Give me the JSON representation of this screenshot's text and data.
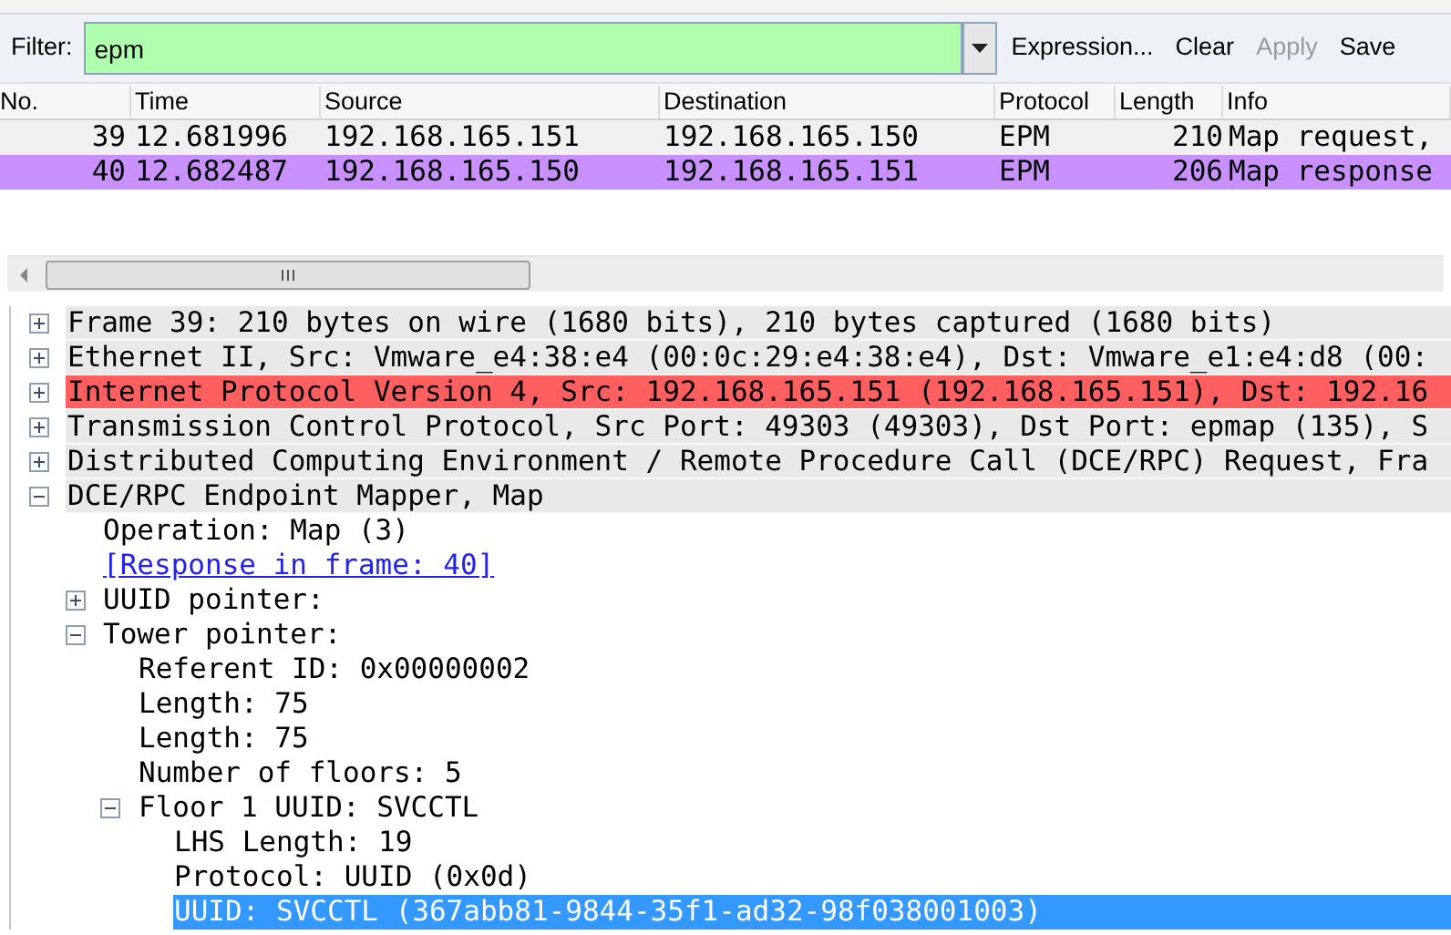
{
  "filter": {
    "label": "Filter:",
    "value": "epm",
    "valid": true,
    "buttons": [
      {
        "label": "Expression...",
        "disabled": false
      },
      {
        "label": "Clear",
        "disabled": false
      },
      {
        "label": "Apply",
        "disabled": true
      },
      {
        "label": "Save",
        "disabled": false
      }
    ]
  },
  "packet_list": {
    "columns": [
      "No.",
      "Time",
      "Source",
      "Destination",
      "Protocol",
      "Length",
      "Info"
    ],
    "rows": [
      {
        "cells": [
          "39",
          "12.681996",
          "192.168.165.151",
          "192.168.165.150",
          "EPM",
          "210",
          "Map request,"
        ],
        "color": "#f0f0f0"
      },
      {
        "cells": [
          "40",
          "12.682487",
          "192.168.165.150",
          "192.168.165.151",
          "EPM",
          "206",
          "Map response"
        ],
        "color": "#c891ff"
      }
    ]
  },
  "details": [
    {
      "text": "Frame 39: 210 bytes on wire (1680 bits), 210 bytes captured (1680 bits)",
      "expanded": false,
      "selected": false
    },
    {
      "text": "Ethernet II, Src: Vmware_e4:38:e4 (00:0c:29:e4:38:e4), Dst: Vmware_e1:e4:d8 (00:",
      "expanded": false,
      "selected": false
    },
    {
      "text": "Internet Protocol Version 4, Src: 192.168.165.151 (192.168.165.151), Dst: 192.16",
      "expanded": false,
      "selected": false,
      "color": "#ff5f5f"
    },
    {
      "text": "Transmission Control Protocol, Src Port: 49303 (49303), Dst Port: epmap (135), S",
      "expanded": false,
      "selected": false
    },
    {
      "text": "Distributed Computing Environment / Remote Procedure Call (DCE/RPC) Request, Fra",
      "expanded": false,
      "selected": false
    },
    {
      "text": "DCE/RPC Endpoint Mapper, Map",
      "expanded": true,
      "selected": false,
      "children": [
        {
          "text": "Operation: Map (3)",
          "selected": false
        },
        {
          "text": "[Response in frame: 40]",
          "kind": "link",
          "selected": false
        },
        {
          "text": "UUID pointer:",
          "expanded": false,
          "selected": false
        },
        {
          "text": "Tower pointer:",
          "expanded": true,
          "selected": false,
          "children": [
            {
              "text": "Referent ID: 0x00000002",
              "selected": false
            },
            {
              "text": "Length: 75",
              "selected": false
            },
            {
              "text": "Length: 75",
              "selected": false
            },
            {
              "text": "Number of floors: 5",
              "selected": false
            },
            {
              "text": "Floor 1 UUID: SVCCTL",
              "expanded": true,
              "selected": false,
              "children": [
                {
                  "text": "LHS Length: 19",
                  "selected": false
                },
                {
                  "text": "Protocol: UUID (0x0d)",
                  "selected": false
                },
                {
                  "text": "UUID: SVCCTL (367abb81-9844-35f1-ad32-98f038001003)",
                  "selected": true
                }
              ]
            }
          ]
        }
      ]
    }
  ]
}
